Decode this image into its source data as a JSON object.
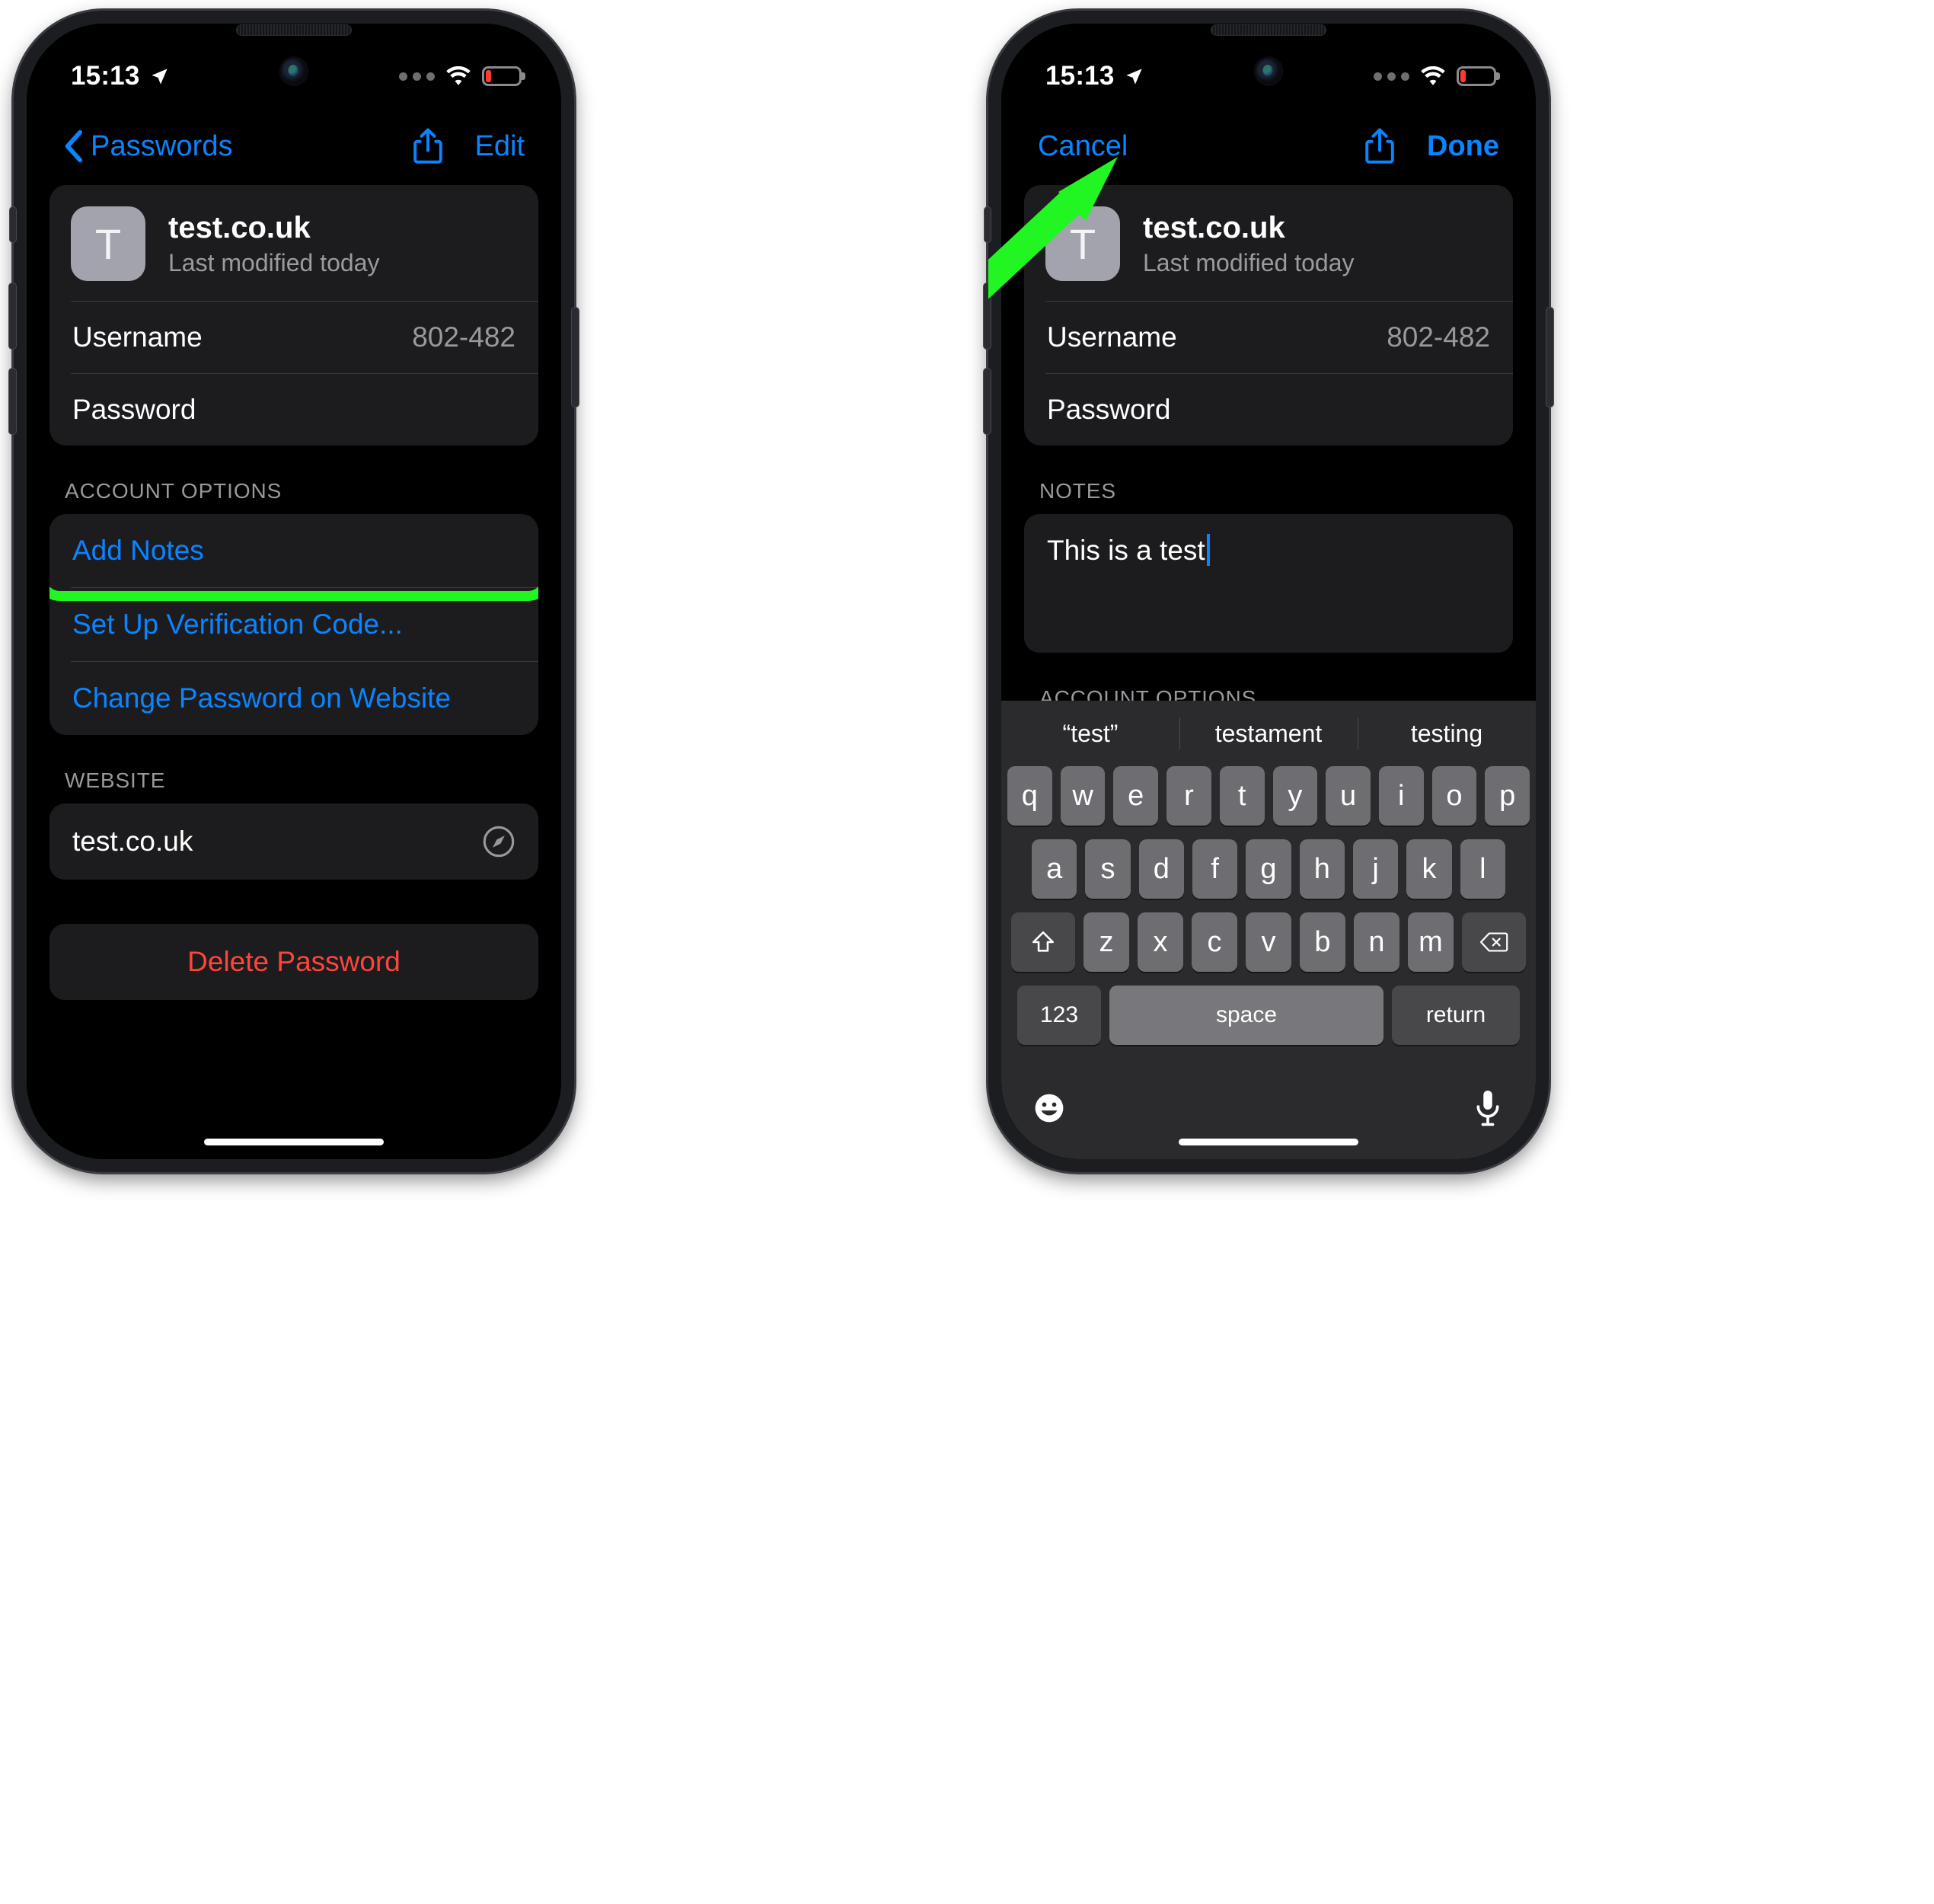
{
  "status_bar": {
    "time": "15:13",
    "location_icon": "location-arrow-icon",
    "signal_icon": "signal-dots-icon",
    "wifi_icon": "wifi-icon",
    "battery_icon": "battery-low-icon",
    "battery_color": "#ff453a"
  },
  "colors": {
    "accent_blue": "#0a84ff",
    "destructive_red": "#ff453a",
    "annotation_green": "#21f522",
    "card_bg": "#1c1c1e",
    "screen_bg": "#000000"
  },
  "left_phone": {
    "nav": {
      "back_label": "Passwords",
      "back_icon": "chevron-left-icon",
      "share_icon": "share-icon",
      "edit_label": "Edit"
    },
    "account": {
      "favicon_letter": "T",
      "name": "test.co.uk",
      "subtitle": "Last modified today",
      "fields": [
        {
          "label": "Username",
          "value": "802-482"
        },
        {
          "label": "Password",
          "value": ""
        }
      ]
    },
    "account_options": {
      "header": "ACCOUNT OPTIONS",
      "items": [
        {
          "label": "Add Notes",
          "highlighted": true
        },
        {
          "label": "Set Up Verification Code...",
          "highlighted": false
        },
        {
          "label": "Change Password on Website",
          "highlighted": false
        }
      ]
    },
    "website": {
      "header": "WEBSITE",
      "value": "test.co.uk",
      "open_icon": "compass-safari-icon"
    },
    "delete": {
      "label": "Delete Password"
    }
  },
  "right_phone": {
    "nav": {
      "cancel_label": "Cancel",
      "share_icon": "share-icon",
      "done_label": "Done"
    },
    "account": {
      "favicon_letter": "T",
      "name": "test.co.uk",
      "subtitle": "Last modified today",
      "fields": [
        {
          "label": "Username",
          "value": "802-482"
        },
        {
          "label": "Password",
          "value": ""
        }
      ]
    },
    "notes": {
      "header": "NOTES",
      "value": "This is a test"
    },
    "account_options_header": "ACCOUNT OPTIONS",
    "keyboard": {
      "suggestions": [
        "“test”",
        "testament",
        "testing"
      ],
      "row1": [
        "q",
        "w",
        "e",
        "r",
        "t",
        "y",
        "u",
        "i",
        "o",
        "p"
      ],
      "row2": [
        "a",
        "s",
        "d",
        "f",
        "g",
        "h",
        "j",
        "k",
        "l"
      ],
      "row3_letters": [
        "z",
        "x",
        "c",
        "v",
        "b",
        "n",
        "m"
      ],
      "shift_icon": "shift-arrow-icon",
      "backspace_icon": "backspace-icon",
      "numbers_label": "123",
      "space_label": "space",
      "return_label": "return",
      "emoji_icon": "emoji-smiley-icon",
      "mic_icon": "microphone-icon"
    }
  },
  "annotations": {
    "arrow_target": "done-button",
    "highlight_target": "add-notes-row",
    "color": "#21f522"
  }
}
